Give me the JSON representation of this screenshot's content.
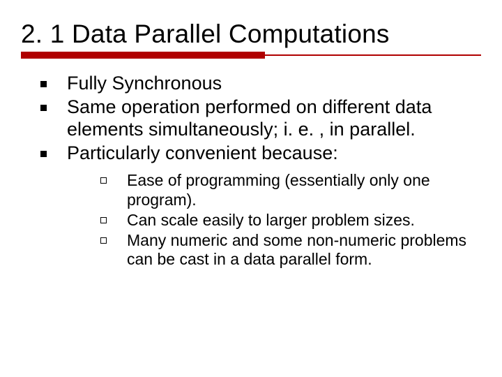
{
  "title": "2. 1 Data Parallel Computations",
  "bullets": [
    {
      "text": "Fully Synchronous"
    },
    {
      "text": "Same operation performed on different data elements simultaneously; i. e. , in parallel."
    },
    {
      "text": "Particularly convenient because:"
    }
  ],
  "sub_bullets": [
    {
      "text": "Ease of programming (essentially only one program)."
    },
    {
      "text": "Can scale easily to larger problem sizes."
    },
    {
      "text": "Many numeric and some non-numeric problems can be cast in a data parallel form."
    }
  ]
}
